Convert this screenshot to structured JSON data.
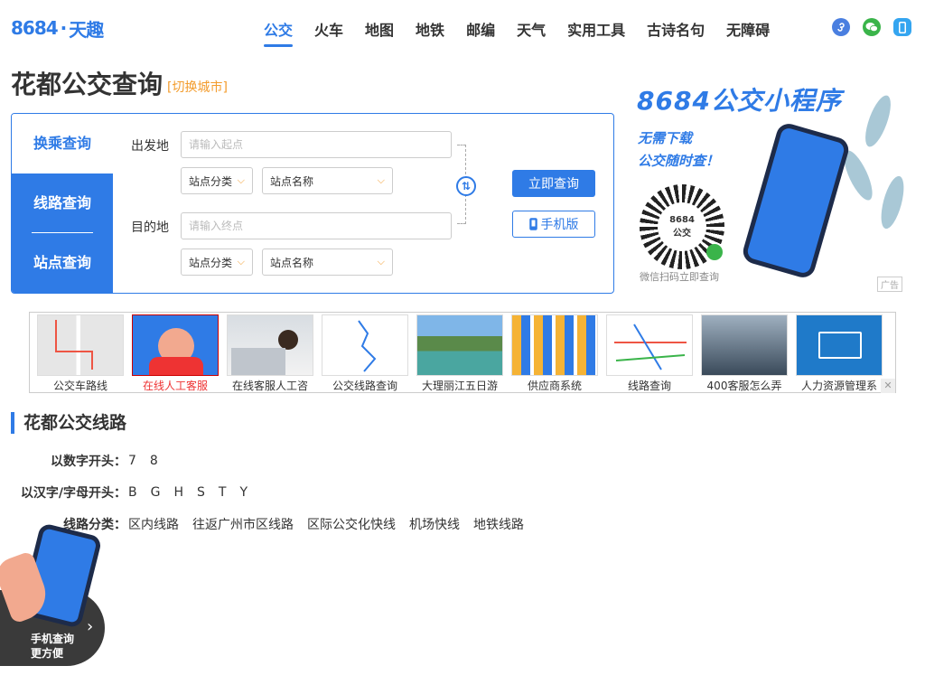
{
  "header": {
    "logo_num": "8684",
    "logo_dot": "·",
    "logo_text": "天趣",
    "nav": [
      {
        "label": "公交",
        "active": true
      },
      {
        "label": "火车"
      },
      {
        "label": "地图"
      },
      {
        "label": "地铁"
      },
      {
        "label": "邮编"
      },
      {
        "label": "天气"
      },
      {
        "label": "实用工具"
      },
      {
        "label": "古诗名句"
      },
      {
        "label": "无障碍"
      }
    ]
  },
  "page": {
    "title": "花都公交查询",
    "switch_city": "[切换城市]"
  },
  "search": {
    "tabs": {
      "transfer": "换乘查询",
      "line": "线路查询",
      "stop": "站点查询"
    },
    "from_label": "出发地",
    "to_label": "目的地",
    "from_placeholder": "请输入起点",
    "to_placeholder": "请输入终点",
    "category_select": "站点分类",
    "name_select": "站点名称",
    "query_button": "立即查询",
    "mobile_button": "手机版"
  },
  "promo": {
    "title": "8684公交小程序",
    "line1": "无需下载",
    "line2": "公交随时查！",
    "qr_text1": "8684",
    "qr_text2": "公交",
    "caption": "微信扫码立即查询",
    "ad_tag": "广告"
  },
  "ad_strip": [
    {
      "label": "公交车路线"
    },
    {
      "label": "在线人工客服",
      "highlight": true
    },
    {
      "label": "在线客服人工咨"
    },
    {
      "label": "公交线路查询"
    },
    {
      "label": "大理丽江五日游"
    },
    {
      "label": "供应商系统"
    },
    {
      "label": "线路查询"
    },
    {
      "label": "400客服怎么弄"
    },
    {
      "label": "人力资源管理系"
    }
  ],
  "lines": {
    "section_title": "花都公交线路",
    "by_number_label": "以数字开头：",
    "by_number": [
      "7",
      "8"
    ],
    "by_letter_label": "以汉字/字母开头：",
    "by_letter": [
      "B",
      "G",
      "H",
      "S",
      "T",
      "Y"
    ],
    "category_label": "线路分类：",
    "categories": [
      "区内线路",
      "往返广州市区线路",
      "区际公交化快线",
      "机场快线",
      "地铁线路"
    ]
  },
  "float_promo": {
    "line1": "手机查询",
    "line2": "更方便"
  },
  "colors": {
    "accent": "#2f7be6",
    "orange": "#f39c2d"
  }
}
